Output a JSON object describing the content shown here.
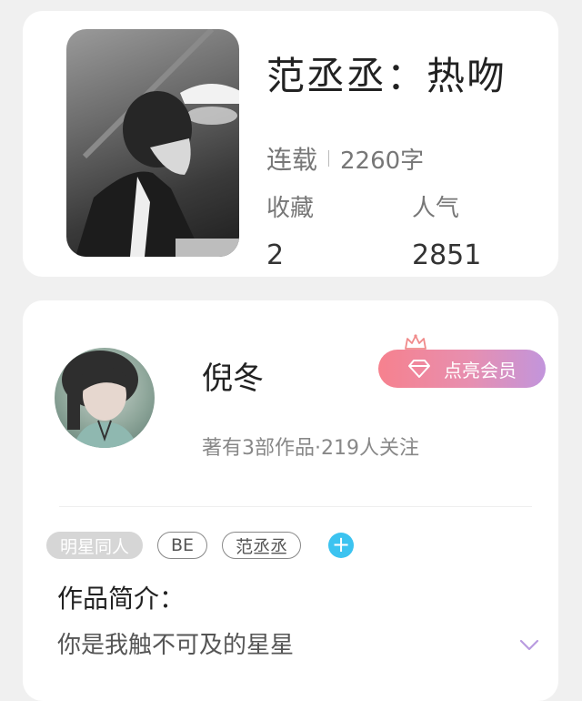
{
  "book": {
    "title": "范丞丞：热吻",
    "status": "连载",
    "word_count": "2260字",
    "favorites_label": "收藏",
    "favorites_value": "2",
    "popularity_label": "人气",
    "popularity_value": "2851"
  },
  "author": {
    "name": "倪冬",
    "meta": "著有3部作品·219人关注",
    "vip_button_label": "点亮会员"
  },
  "tags": [
    "明星同人",
    "BE",
    "范丞丞"
  ],
  "intro": {
    "title": "作品简介：",
    "text": "你是我触不可及的星星"
  },
  "colors": {
    "vip_gradient_start": "#f6818e",
    "vip_gradient_end": "#c295dc",
    "add_tag": "#3cc3f0",
    "expand_arrow": "#b99be0"
  },
  "icons": {
    "crown": "crown-icon",
    "diamond": "diamond-icon",
    "add": "plus-icon",
    "expand": "chevron-down-icon"
  }
}
